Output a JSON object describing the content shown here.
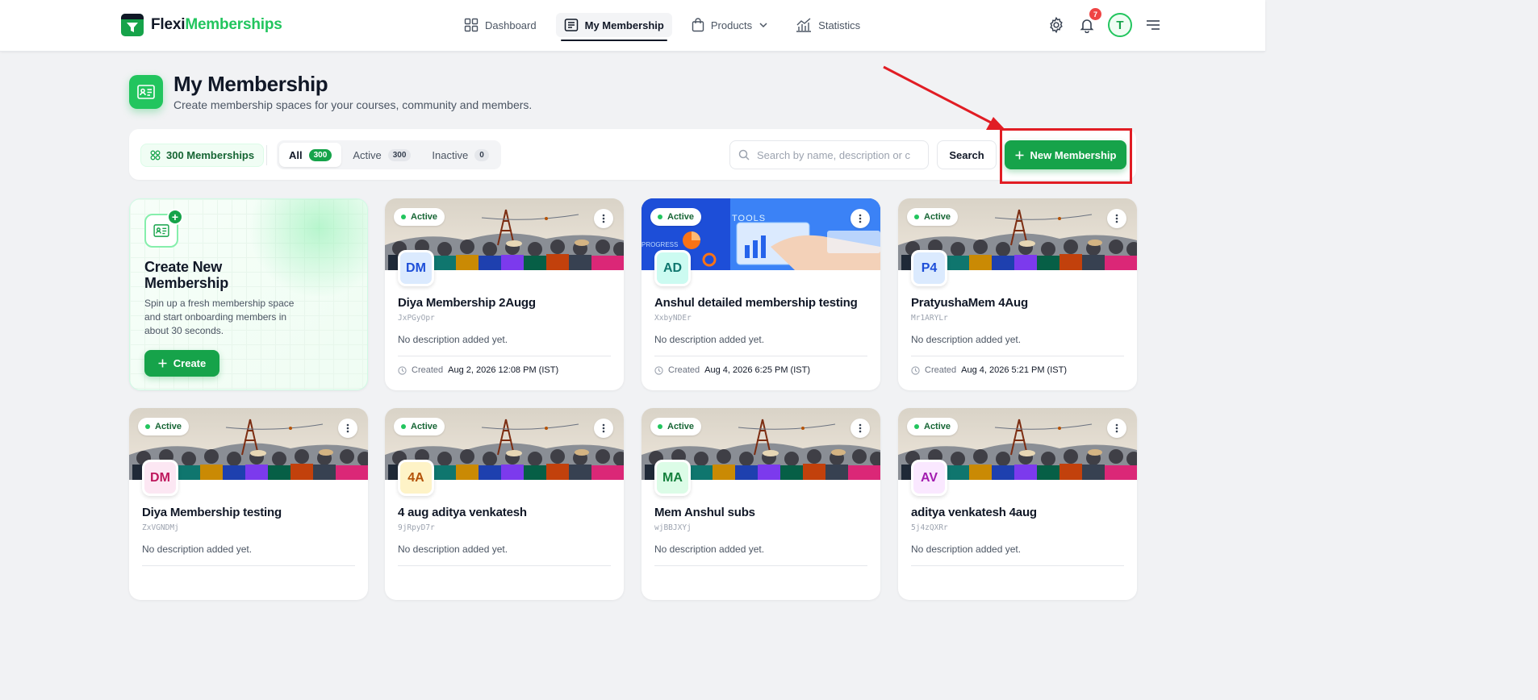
{
  "brand": {
    "name_a": "Flexi",
    "name_b": "Memberships"
  },
  "nav": {
    "items": [
      {
        "label": "Dashboard",
        "icon": "grid-icon"
      },
      {
        "label": "My Membership",
        "icon": "membership-icon",
        "active": true
      },
      {
        "label": "Products",
        "icon": "bag-icon",
        "has_dropdown": true
      },
      {
        "label": "Statistics",
        "icon": "chart-icon"
      }
    ]
  },
  "header_tools": {
    "notification_count": "7",
    "avatar_initial": "T"
  },
  "page": {
    "title": "My Membership",
    "subtitle": "Create membership spaces for your courses, community and members."
  },
  "filters": {
    "total_label": "300 Memberships",
    "tabs": [
      {
        "label": "All",
        "count": "300",
        "active": true
      },
      {
        "label": "Active",
        "count": "300"
      },
      {
        "label": "Inactive",
        "count": "0"
      }
    ],
    "search_placeholder": "Search by name, description or c",
    "search_button": "Search",
    "new_button": "New Membership"
  },
  "create_card": {
    "title": "Create New Membership",
    "description": "Spin up a fresh membership space and start onboarding members in about 30 seconds.",
    "button": "Create"
  },
  "created_prefix": "Created",
  "memberships": [
    {
      "status": "Active",
      "initials": "DM",
      "name": "Diya Membership 2Augg",
      "code": "JxPGyOpr",
      "description": "No description added yet.",
      "created": "Aug 2, 2026 12:08 PM (IST)",
      "banner": "photo",
      "avatar_bg": "#dbeafe",
      "avatar_fg": "#1d4ed8"
    },
    {
      "status": "Active",
      "initials": "AD",
      "name": "Anshul detailed membership testing",
      "code": "XxbyNDEr",
      "description": "No description added yet.",
      "created": "Aug 4, 2026 6:25 PM (IST)",
      "banner": "tools",
      "avatar_bg": "#ccfbf1",
      "avatar_fg": "#0f766e"
    },
    {
      "status": "Active",
      "initials": "P4",
      "name": "PratyushaMem 4Aug",
      "code": "Mr1ARYLr",
      "description": "No description added yet.",
      "created": "Aug 4, 2026 5:21 PM (IST)",
      "banner": "photo",
      "avatar_bg": "#dbeafe",
      "avatar_fg": "#1d4ed8"
    },
    {
      "status": "Active",
      "initials": "DM",
      "name": "Diya Membership testing",
      "code": "ZxVGNDMj",
      "description": "No description added yet.",
      "created": "",
      "banner": "photo",
      "avatar_bg": "#fce7f3",
      "avatar_fg": "#be185d"
    },
    {
      "status": "Active",
      "initials": "4A",
      "name": "4 aug aditya venkatesh",
      "code": "9jRpyD7r",
      "description": "No description added yet.",
      "created": "",
      "banner": "photo",
      "avatar_bg": "#fef3c7",
      "avatar_fg": "#b45309"
    },
    {
      "status": "Active",
      "initials": "MA",
      "name": "Mem Anshul subs",
      "code": "wjBBJXYj",
      "description": "No description added yet.",
      "created": "",
      "banner": "photo",
      "avatar_bg": "#dcfce7",
      "avatar_fg": "#15803d"
    },
    {
      "status": "Active",
      "initials": "AV",
      "name": "aditya venkatesh 4aug",
      "code": "5j4zQXRr",
      "description": "No description added yet.",
      "created": "",
      "banner": "photo",
      "avatar_bg": "#fae8ff",
      "avatar_fg": "#a21caf"
    }
  ],
  "colors": {
    "accent": "#16a34a",
    "annotation": "#e11d24"
  }
}
